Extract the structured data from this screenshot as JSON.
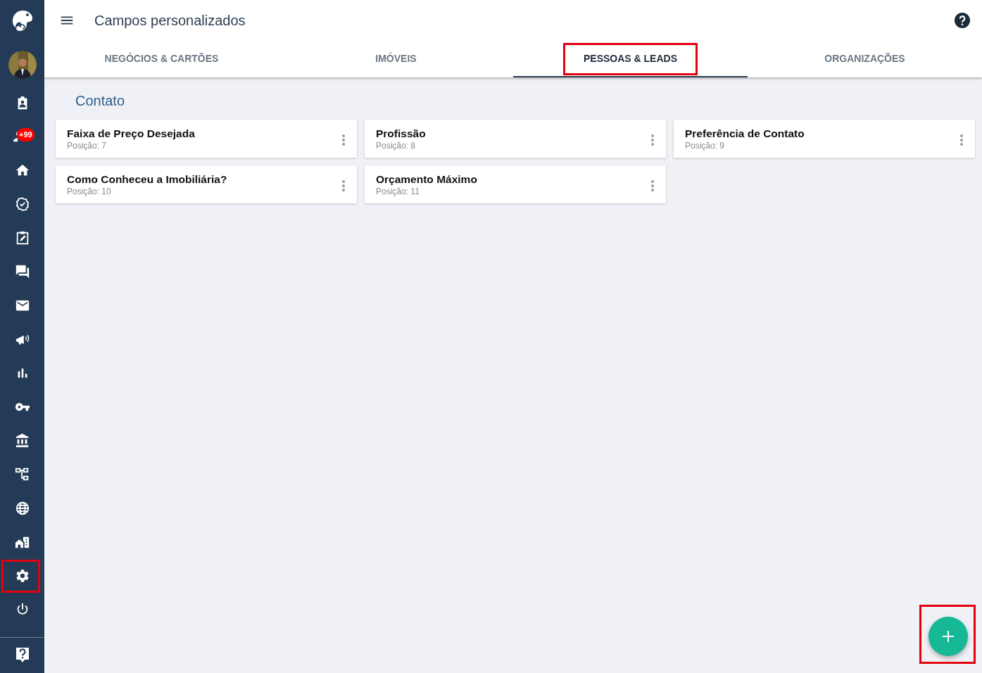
{
  "header": {
    "title": "Campos personalizados"
  },
  "sidebar": {
    "items": [
      {
        "kind": "contacts",
        "highlighted": false
      },
      {
        "kind": "notifications",
        "badge": "+99",
        "highlighted": false
      },
      {
        "kind": "home",
        "highlighted": false
      },
      {
        "kind": "verified",
        "highlighted": false
      },
      {
        "kind": "tasks",
        "highlighted": false
      },
      {
        "kind": "chat",
        "highlighted": false
      },
      {
        "kind": "mail",
        "highlighted": false
      },
      {
        "kind": "campaigns",
        "highlighted": false
      },
      {
        "kind": "reports",
        "highlighted": false
      },
      {
        "kind": "keys",
        "highlighted": false
      },
      {
        "kind": "bank",
        "highlighted": false
      },
      {
        "kind": "hierarchy",
        "highlighted": false
      },
      {
        "kind": "web",
        "highlighted": false
      },
      {
        "kind": "properties",
        "highlighted": false
      },
      {
        "kind": "settings",
        "highlighted": true
      },
      {
        "kind": "logout",
        "highlighted": false
      }
    ]
  },
  "tabs": [
    {
      "label": "NEGÓCIOS & CARTÕES",
      "selected": false,
      "highlighted": false
    },
    {
      "label": "IMÓVEIS",
      "selected": false,
      "highlighted": false
    },
    {
      "label": "PESSOAS & LEADS",
      "selected": true,
      "highlighted": true
    },
    {
      "label": "ORGANIZAÇÕES",
      "selected": false,
      "highlighted": false
    }
  ],
  "section": {
    "title": "Contato",
    "fields": [
      {
        "name": "Faixa de Preço Desejada",
        "position": "Posição: 7"
      },
      {
        "name": "Profissão",
        "position": "Posição: 8"
      },
      {
        "name": "Preferência de Contato",
        "position": "Posição: 9"
      },
      {
        "name": "Como Conheceu a Imobiliária?",
        "position": "Posição: 10"
      },
      {
        "name": "Orçamento Máximo",
        "position": "Posição: 11"
      }
    ]
  },
  "add_button": {
    "highlighted": true
  }
}
